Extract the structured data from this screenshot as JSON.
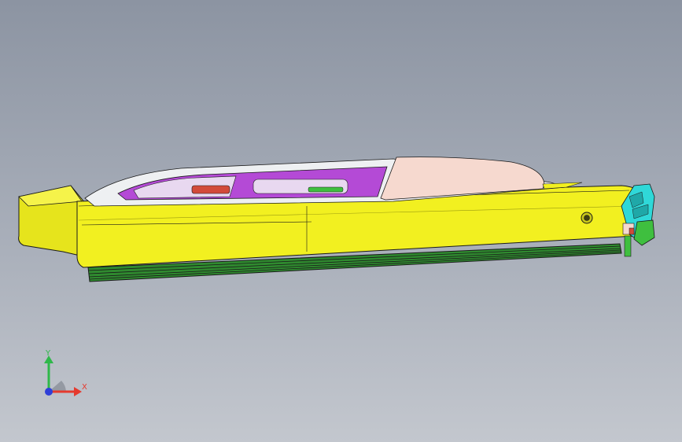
{
  "viewport": {
    "background_top": "#8c94a2",
    "background_bottom": "#c3c7ce"
  },
  "model": {
    "colors": {
      "body": "#f2f020",
      "body_shade": "#c9c81a",
      "top_cover": "#f6d9cf",
      "cavity": "#b44ad6",
      "cavity_light": "#e8d8f0",
      "rail": "#2f8a2f",
      "detail_cyan": "#2fd8d8",
      "detail_green": "#3fbf3f",
      "detail_red": "#d24a3a",
      "edge": "#1a1a1a"
    }
  },
  "triad": {
    "x_label": "X",
    "y_label": "Y",
    "x_color": "#e53a2e",
    "y_color": "#2fb84a",
    "z_color": "#2f3fd8"
  }
}
